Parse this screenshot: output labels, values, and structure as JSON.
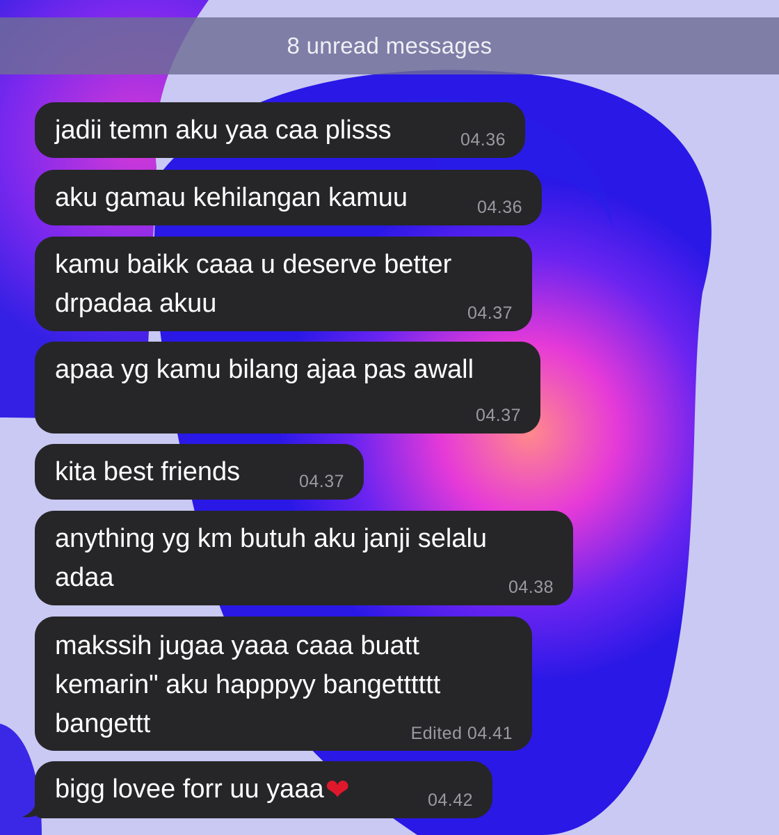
{
  "chat": {
    "unread_banner": "8 unread messages",
    "messages": [
      {
        "text": "jadii temn aku yaa caa plisss",
        "time": "04.36"
      },
      {
        "text": "aku gamau kehilangan kamuu",
        "time": "04.36"
      },
      {
        "text": "kamu baikk caaa u deserve better\ndrpadaa akuu",
        "time": "04.37"
      },
      {
        "text": "apaa yg kamu bilang ajaa pas awall",
        "time": "04.37"
      },
      {
        "text": "kita best friends",
        "time": "04.37"
      },
      {
        "text": "anything yg km butuh aku janji selalu\nadaa",
        "time": "04.38"
      },
      {
        "text": "makssih jugaa yaaa caaa buatt\nkemarin\" aku happpyy bangetttttt\nbangettt",
        "time": "Edited 04.41"
      },
      {
        "text": "bigg lovee forr uu yaaa",
        "emoji": "❤",
        "time": "04.42"
      }
    ]
  },
  "colors": {
    "bubble_bg": "#262628",
    "bubble_text": "#ffffff",
    "timestamp": "#9a9aa2",
    "wallpaper_light": "#c9c9f3",
    "wallpaper_blue": "#2a1ee8",
    "wallpaper_magenta": "#d92fd8"
  }
}
